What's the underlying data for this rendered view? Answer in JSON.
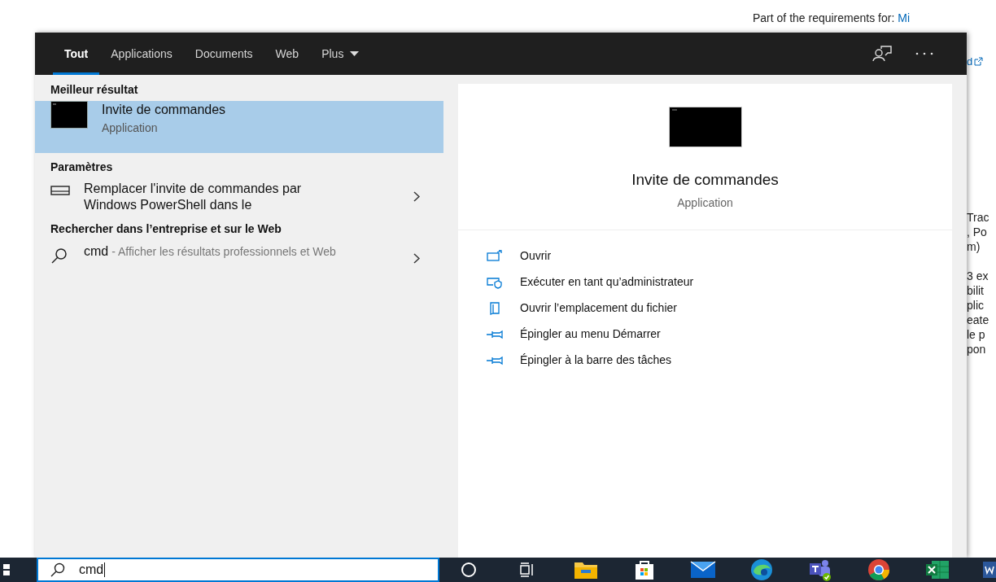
{
  "background_page": {
    "requirements_label": "Part of the requirements for:",
    "requirements_link": "Mi",
    "link_fragment": "d",
    "fragments": [
      "Trac",
      ", Po",
      "m)",
      "3 ex",
      "bilit",
      "plic",
      "eate",
      "le p",
      "pon"
    ]
  },
  "search_panel": {
    "tabs": [
      {
        "label": "Tout",
        "selected": true
      },
      {
        "label": "Applications",
        "selected": false
      },
      {
        "label": "Documents",
        "selected": false
      },
      {
        "label": "Web",
        "selected": false
      },
      {
        "label": "Plus",
        "selected": false,
        "kind": "dropdown"
      }
    ],
    "sections": [
      {
        "heading": "Meilleur résultat",
        "items": [
          {
            "kind": "app",
            "title": "Invite de commandes",
            "subtitle": "Application",
            "selected": true
          }
        ]
      },
      {
        "heading": "Paramètres",
        "items": [
          {
            "kind": "setting",
            "title": "Remplacer l'invite de commandes par Windows PowerShell dans le",
            "selected": false
          }
        ]
      },
      {
        "heading": "Rechercher dans l’entreprise et sur le Web",
        "items": [
          {
            "kind": "web",
            "title": "cmd",
            "subtitle": "- Afficher les résultats professionnels et Web",
            "selected": false
          }
        ]
      }
    ],
    "preview": {
      "title": "Invite de commandes",
      "subtitle": "Application",
      "actions": [
        {
          "kind": "open",
          "label": "Ouvrir"
        },
        {
          "kind": "admin",
          "label": "Exécuter en tant qu’administrateur"
        },
        {
          "kind": "folder",
          "label": "Ouvrir l’emplacement du fichier"
        },
        {
          "kind": "pin",
          "label": "Épingler au menu Démarrer"
        },
        {
          "kind": "pin",
          "label": "Épingler à la barre des tâches"
        }
      ]
    }
  },
  "taskbar": {
    "search_value": "cmd",
    "apps": [
      {
        "kind": "cortana"
      },
      {
        "kind": "taskview"
      },
      {
        "kind": "explorer"
      },
      {
        "kind": "store"
      },
      {
        "kind": "mail"
      },
      {
        "kind": "edge"
      },
      {
        "kind": "teams"
      },
      {
        "kind": "chrome"
      },
      {
        "kind": "excel"
      },
      {
        "kind": "word"
      }
    ]
  }
}
